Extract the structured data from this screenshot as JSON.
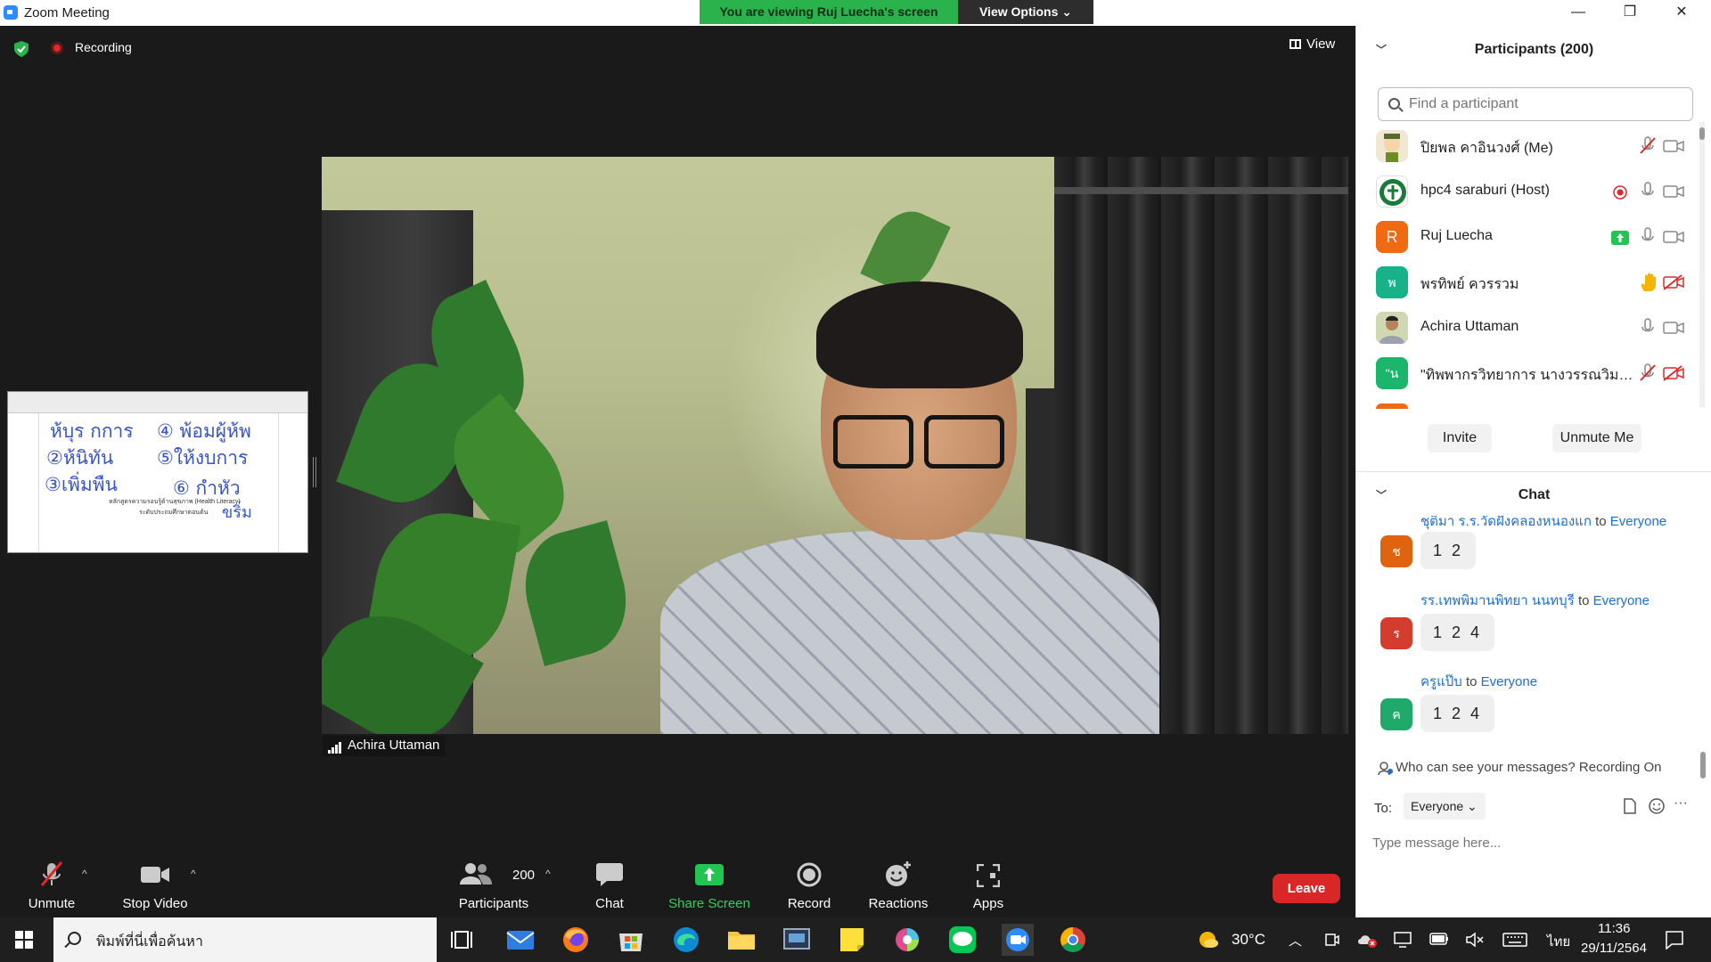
{
  "window": {
    "title": "Zoom Meeting",
    "minimize": "—",
    "restore": "❐",
    "close": "✕"
  },
  "banner": {
    "viewing": "You are viewing Ruj Luecha's screen",
    "view_options": "View Options ⌄"
  },
  "meeting": {
    "recording_label": "Recording",
    "view_label": "View",
    "speaker_name": "Achira Uttaman",
    "thumb": {
      "words": [
        "ห้บุร กการ",
        "④ พ้อมผู้ห้พ",
        "②ห้นิทัน",
        "⑤ให้งบการ",
        "③เพิ่มพืน",
        "⑥ กำหัว",
        "ขริ่ม"
      ],
      "small": [
        "หลักสูตรความรอบรู้ด้านสุขภาพ (Health Literacy)",
        "ระดับประถมศึกษาตอนต้น"
      ]
    }
  },
  "toolbar": {
    "unmute": "Unmute",
    "stop_video": "Stop Video",
    "participants": "Participants",
    "participants_count": "200",
    "chat": "Chat",
    "share_screen": "Share Screen",
    "record": "Record",
    "reactions": "Reactions",
    "apps": "Apps",
    "leave": "Leave",
    "caret": "^"
  },
  "participants": {
    "title": "Participants (200)",
    "search_placeholder": "Find a participant",
    "list": [
      {
        "name": "ปิยพล คาอินวงศ์ (Me)",
        "avatar": "",
        "avatar_color": "#f1e7d3"
      },
      {
        "name": "hpc4 saraburi (Host)",
        "avatar": "",
        "avatar_color": "#1a7a3a"
      },
      {
        "name": "Ruj Luecha",
        "avatar": "R",
        "avatar_color": "#f06a13"
      },
      {
        "name": "พรทิพย์ ควรรวม",
        "avatar": "พ",
        "avatar_color": "#17b28a"
      },
      {
        "name": "Achira Uttaman",
        "avatar": "",
        "avatar_color": "#7a8f6a"
      },
      {
        "name": "\"ทิพพากรวิทยาการ นางวรรณวิมล คล้า…",
        "avatar": "\"น",
        "avatar_color": "#1bb56b"
      }
    ],
    "invite": "Invite",
    "unmute_me": "Unmute Me"
  },
  "chat": {
    "title": "Chat",
    "messages": [
      {
        "sender": "ชุติมา ร.ร.วัดฝั่งคลองหนองแก",
        "to_word": "to",
        "recipient": "Everyone",
        "text": "1 2",
        "avatar": "ช",
        "avatar_color": "#e0640f"
      },
      {
        "sender": "รร.เทพพิมานพิทยา นนทบุรี",
        "to_word": "to",
        "recipient": "Everyone",
        "text": "1 2 4",
        "avatar": "ร",
        "avatar_color": "#d43c2e"
      },
      {
        "sender": "ครูแป๊บ",
        "to_word": "to",
        "recipient": "Everyone",
        "text": "1 2 4",
        "avatar": "ค",
        "avatar_color": "#1faa6b"
      }
    ],
    "who_can_see": "Who can see your messages? Recording On",
    "to_label": "To:",
    "to_value": "Everyone",
    "input_placeholder": "Type message here...",
    "more": "···"
  },
  "taskbar": {
    "search_text": "พิมพ์ที่นี่เพื่อค้นหา",
    "temperature": "30°C",
    "language": "ไทย",
    "time": "11:36",
    "date": "29/11/2564"
  }
}
